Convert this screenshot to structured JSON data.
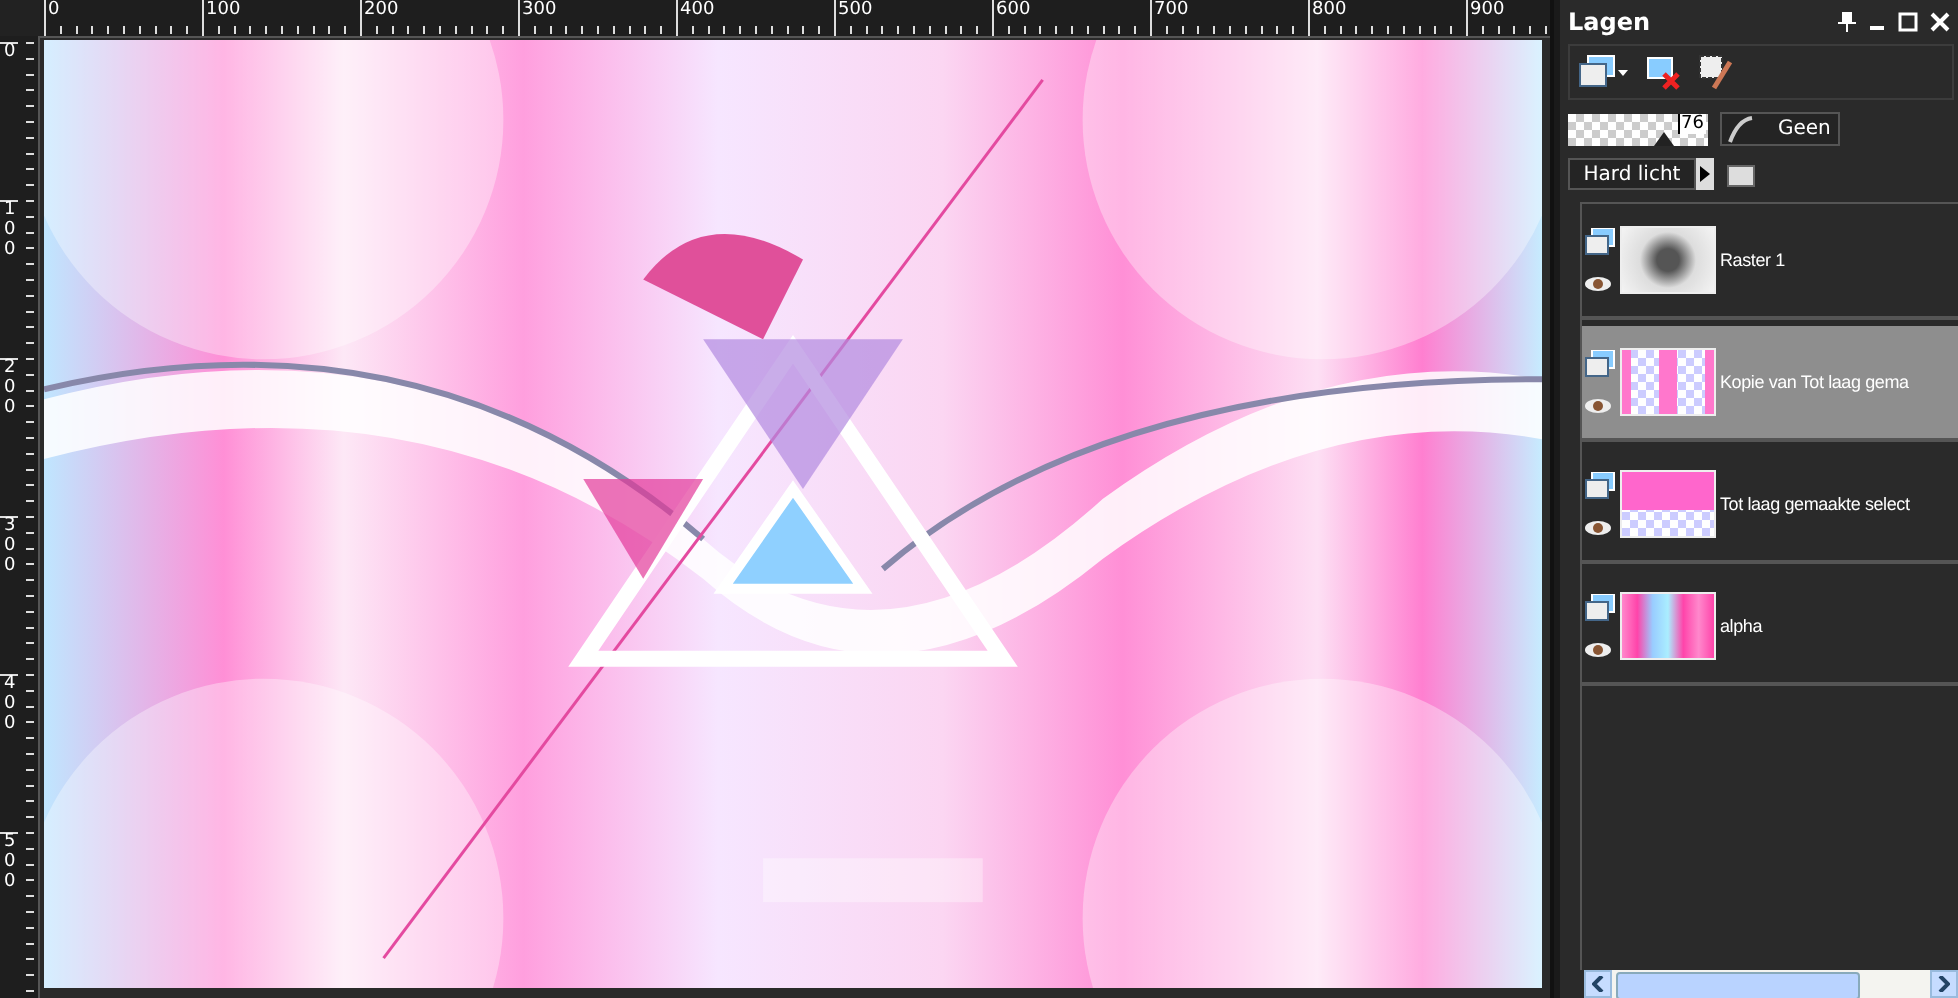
{
  "top_ruler": {
    "labels": [
      "0",
      "100",
      "200",
      "300",
      "400",
      "500",
      "600",
      "700",
      "800",
      "900"
    ]
  },
  "left_ruler": {
    "labels": [
      "0",
      "100",
      "200",
      "300",
      "400",
      "500"
    ]
  },
  "layers_panel": {
    "title": "Lagen",
    "opacity": {
      "level": 0.76,
      "reading": "76"
    },
    "mask_button": "Geen",
    "blend_mode": "Hard licht",
    "layers": [
      {
        "name": "Raster 1",
        "kind": "grayscale",
        "selected": false
      },
      {
        "name": "Kopie van Tot laag gema",
        "kind": "bow-top",
        "selected": true
      },
      {
        "name": "Tot laag gemaakte select",
        "kind": "bow-bottom",
        "selected": false
      },
      {
        "name": "alpha",
        "kind": "stripes",
        "selected": false
      }
    ]
  }
}
